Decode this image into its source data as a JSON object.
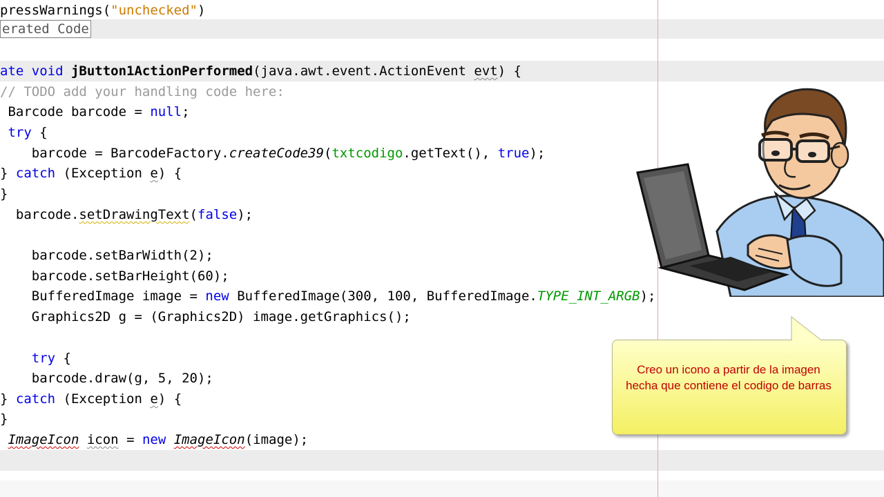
{
  "editor": {
    "line_annotation": [
      "pressWarnings(",
      "\"unchecked\"",
      ")"
    ],
    "fold_label": "erated Code",
    "method_sig": [
      "ate ",
      "void",
      " ",
      "jButton1ActionPerformed",
      "(java.awt.event.ActionEvent ",
      "evt",
      ") {"
    ],
    "comment": "// TODO add your handling code here:",
    "l_barcode_decl": [
      " Barcode barcode = ",
      "null",
      ";"
    ],
    "l_try": [
      " ",
      "try",
      " {"
    ],
    "l_create": [
      "    barcode = BarcodeFactory.",
      "createCode39",
      "(",
      "txtcodigo",
      ".getText(), ",
      "true",
      ");"
    ],
    "l_catch1": [
      "} ",
      "catch",
      " (Exception ",
      "e",
      ") {"
    ],
    "l_close1": "}",
    "l_drawing": [
      "  barcode.",
      "setDrawingText",
      "(",
      "false",
      ");"
    ],
    "l_barwidth": "    barcode.setBarWidth(2);",
    "l_barheight": "    barcode.setBarHeight(60);",
    "l_buffered": [
      "    BufferedImage image = ",
      "new",
      " BufferedImage(300, 100, BufferedImage.",
      "TYPE_INT_ARGB",
      ");"
    ],
    "l_graphics": "    Graphics2D g = (Graphics2D) image.getGraphics();",
    "l_try2": [
      "    ",
      "try",
      " {"
    ],
    "l_draw": "    barcode.draw(g, 5, 20);",
    "l_catch2": [
      "} ",
      "catch",
      " (Exception ",
      "e",
      ") {"
    ],
    "l_close2": "}",
    "l_icon": [
      " ",
      "ImageIcon",
      " ",
      "icon",
      " = ",
      "new",
      " ",
      "ImageIcon",
      "(image);"
    ]
  },
  "callout": {
    "text": "Creo un icono a partir de la imagen hecha que contiene el codigo de barras"
  },
  "colors": {
    "keyword": "#0000e6",
    "string": "#ce7b00",
    "comment": "#9a9a9a",
    "field": "#009900",
    "callout_text": "#c00000",
    "margin_line": "#f2a0a0"
  }
}
